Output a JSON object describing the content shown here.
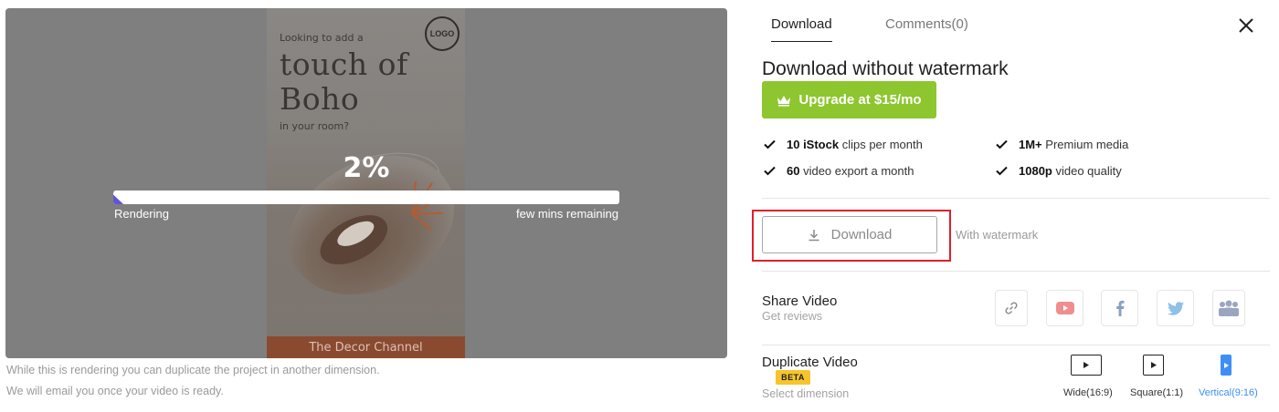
{
  "preview": {
    "story": {
      "line1": "Looking to add a",
      "line2": "touch of",
      "line3": "Boho",
      "line4": "in your room?",
      "logo": "LOGO",
      "footer": "The Decor Channel"
    },
    "progress_percent_label": "2%",
    "progress_fraction": 0.02,
    "status_left": "Rendering",
    "status_right": "few mins remaining",
    "progress_color": "#5b57d8"
  },
  "notes": {
    "line1": "While this is rendering you can duplicate the project in another dimension.",
    "line2": "We will email you once your video is ready."
  },
  "tabs": [
    {
      "label": "Download",
      "active": true
    },
    {
      "label": "Comments(0)",
      "active": false
    }
  ],
  "close_icon": "close-icon",
  "upgrade": {
    "heading": "Download without watermark",
    "button_label": "Upgrade at $15/mo",
    "button_color": "#8dc62e",
    "icon": "crown-icon"
  },
  "features": [
    {
      "bold": "10 iStock",
      "rest": " clips per month"
    },
    {
      "bold": "1M+",
      "rest": " Premium media"
    },
    {
      "bold": "60",
      "rest": " video export a month"
    },
    {
      "bold": "1080p",
      "rest": " video quality"
    }
  ],
  "download": {
    "button_label": "Download",
    "note": "With watermark",
    "highlight_color": "#e0202a"
  },
  "share": {
    "title": "Share Video",
    "subtitle": "Get reviews",
    "icons": [
      "link-icon",
      "youtube-icon",
      "facebook-icon",
      "twitter-icon",
      "team-icon"
    ]
  },
  "duplicate": {
    "title": "Duplicate Video",
    "badge": "BETA",
    "subtitle": "Select dimension",
    "options": [
      {
        "label": "Wide(16:9)",
        "selected": false
      },
      {
        "label": "Square(1:1)",
        "selected": false
      },
      {
        "label": "Vertical(9:16)",
        "selected": true
      }
    ],
    "selected_color": "#3d8ff5"
  }
}
